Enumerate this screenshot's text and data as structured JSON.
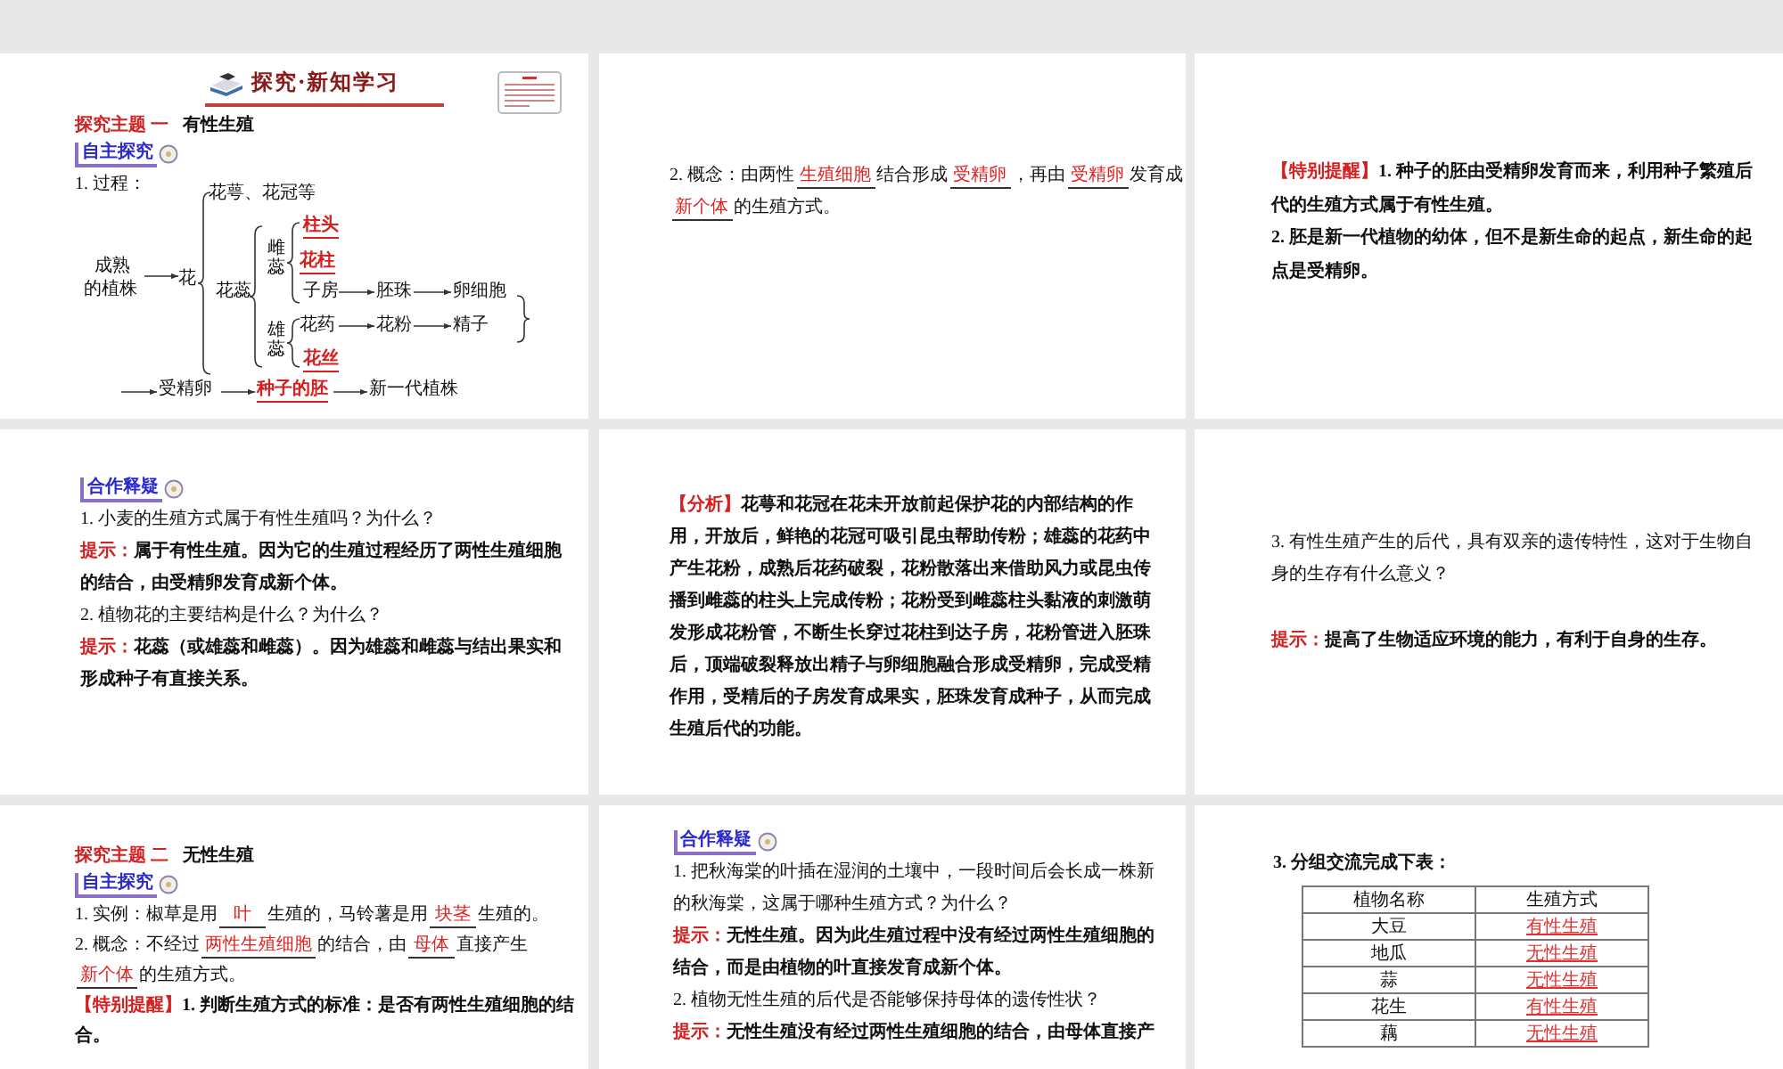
{
  "slides": [
    {
      "blocks": [
        {
          "kind": "banner",
          "text": "探究·新知学习"
        },
        {
          "kind": "topic",
          "label": "探究主题 一",
          "title": "有性生殖"
        },
        {
          "kind": "tag",
          "text": "自主探究"
        },
        {
          "kind": "para",
          "runs": [
            {
              "kind": "t",
              "text": "1. 过程："
            }
          ]
        },
        {
          "kind": "diagram",
          "nodes": [
            {
              "text": "花萼、花冠等",
              "red": false
            },
            {
              "text": "成熟",
              "red": false
            },
            {
              "text": "的植株",
              "red": false
            },
            {
              "text": "花",
              "red": false
            },
            {
              "text": "花蕊",
              "red": false
            },
            {
              "text": "雌蕊",
              "red": false
            },
            {
              "text": "柱头",
              "red": true
            },
            {
              "text": "花柱",
              "red": true
            },
            {
              "text": "子房",
              "red": false
            },
            {
              "text": "胚珠",
              "red": false
            },
            {
              "text": "卵细胞",
              "red": false
            },
            {
              "text": "雄蕊",
              "red": false
            },
            {
              "text": "花药",
              "red": false
            },
            {
              "text": "花粉",
              "red": false
            },
            {
              "text": "精子",
              "red": false
            },
            {
              "text": "花丝",
              "red": true
            },
            {
              "text": "受精卵",
              "red": false
            },
            {
              "text": "种子的胚",
              "red": true
            },
            {
              "text": "新一代植株",
              "red": false
            }
          ]
        }
      ]
    },
    {
      "blocks": [
        {
          "kind": "para",
          "runs": [
            {
              "kind": "t",
              "text": "2. 概念：由两性"
            },
            {
              "kind": "blank",
              "text": "生殖细胞"
            },
            {
              "kind": "t",
              "text": "结合形成"
            },
            {
              "kind": "blank",
              "text": "受精卵"
            },
            {
              "kind": "t",
              "text": "，再由"
            },
            {
              "kind": "blank",
              "text": "受精卵"
            },
            {
              "kind": "t",
              "text": "发育成"
            },
            {
              "kind": "blank",
              "text": "新个体"
            },
            {
              "kind": "t",
              "text": "的生殖方式。"
            }
          ]
        }
      ]
    },
    {
      "blocks": [
        {
          "kind": "para",
          "runs": [
            {
              "kind": "r",
              "text": "【特别提醒】"
            },
            {
              "kind": "b",
              "text": "1. 种子的胚由受精卵发育而来，利用种子繁殖后代的生殖方式属于有性生殖。"
            }
          ]
        },
        {
          "kind": "para",
          "runs": [
            {
              "kind": "b",
              "text": "2. 胚是新一代植物的幼体，但不是新生命的起点，新生命的起点是受精卵。"
            }
          ]
        }
      ]
    },
    {
      "blocks": [
        {
          "kind": "tag",
          "text": "合作释疑"
        },
        {
          "kind": "para",
          "runs": [
            {
              "kind": "t",
              "text": "1. 小麦的生殖方式属于有性生殖吗？为什么？"
            }
          ]
        },
        {
          "kind": "para",
          "runs": [
            {
              "kind": "r",
              "text": "提示："
            },
            {
              "kind": "b",
              "text": "属于有性生殖。因为它的生殖过程经历了两性生殖细胞的结合，由受精卵发育成新个体。"
            }
          ]
        },
        {
          "kind": "para",
          "runs": [
            {
              "kind": "t",
              "text": "2. 植物花的主要结构是什么？为什么？"
            }
          ]
        },
        {
          "kind": "para",
          "runs": [
            {
              "kind": "r",
              "text": "提示："
            },
            {
              "kind": "b",
              "text": "花蕊（或雄蕊和雌蕊）。因为雄蕊和雌蕊与结出果实和形成种子有直接关系。"
            }
          ]
        }
      ]
    },
    {
      "blocks": [
        {
          "kind": "para",
          "runs": [
            {
              "kind": "r",
              "text": "【分析】"
            },
            {
              "kind": "b",
              "text": "花萼和花冠在花未开放前起保护花的内部结构的作用，开放后，鲜艳的花冠可吸引昆虫帮助传粉；雄蕊的花药中产生花粉，成熟后花药破裂，花粉散落出来借助风力或昆虫传播到雌蕊的柱头上完成传粉；花粉受到雌蕊柱头黏液的刺激萌发形成花粉管，不断生长穿过花柱到达子房，花粉管进入胚珠后，顶端破裂释放出精子与卵细胞融合形成受精卵，完成受精作用，受精后的子房发育成果实，胚珠发育成种子，从而完成生殖后代的功能。"
            }
          ]
        }
      ]
    },
    {
      "blocks": [
        {
          "kind": "para",
          "runs": [
            {
              "kind": "t",
              "text": "3. 有性生殖产生的后代，具有双亲的遗传特性，这对于生物自身的生存有什么意义？"
            }
          ]
        },
        {
          "kind": "para",
          "runs": [
            {
              "kind": "r",
              "text": "提示："
            },
            {
              "kind": "b",
              "text": "提高了生物适应环境的能力，有利于自身的生存。"
            }
          ]
        }
      ]
    },
    {
      "blocks": [
        {
          "kind": "topic",
          "label": "探究主题 二",
          "title": "无性生殖"
        },
        {
          "kind": "tag",
          "text": "自主探究"
        },
        {
          "kind": "para",
          "runs": [
            {
              "kind": "t",
              "text": "1. 实例：椒草是用"
            },
            {
              "kind": "blank",
              "text": "叶"
            },
            {
              "kind": "t",
              "text": "生殖的，马铃薯是用"
            },
            {
              "kind": "blank",
              "text": "块茎"
            },
            {
              "kind": "t",
              "text": "生殖的。"
            }
          ]
        },
        {
          "kind": "para",
          "runs": [
            {
              "kind": "t",
              "text": "2. 概念：不经过"
            },
            {
              "kind": "blank",
              "text": "两性生殖细胞"
            },
            {
              "kind": "t",
              "text": "的结合，由"
            },
            {
              "kind": "blank",
              "text": "母体"
            },
            {
              "kind": "t",
              "text": "直接产生"
            },
            {
              "kind": "blank",
              "text": "新个体"
            },
            {
              "kind": "t",
              "text": "的生殖方式。"
            }
          ]
        },
        {
          "kind": "para",
          "runs": [
            {
              "kind": "r",
              "text": "【特别提醒】"
            },
            {
              "kind": "b",
              "text": "1. 判断生殖方式的标准：是否有两性生殖细胞的结合。"
            }
          ]
        }
      ]
    },
    {
      "blocks": [
        {
          "kind": "tag",
          "text": "合作释疑"
        },
        {
          "kind": "para",
          "runs": [
            {
              "kind": "t",
              "text": "1. 把秋海棠的叶插在湿润的土壤中，一段时间后会长成一株新的秋海棠，这属于哪种生殖方式？为什么？"
            }
          ]
        },
        {
          "kind": "para",
          "runs": [
            {
              "kind": "r",
              "text": "提示："
            },
            {
              "kind": "b",
              "text": "无性生殖。因为此生殖过程中没有经过两性生殖细胞的结合，而是由植物的叶直接发育成新个体。"
            }
          ]
        },
        {
          "kind": "para",
          "runs": [
            {
              "kind": "t",
              "text": "2. 植物无性生殖的后代是否能够保持母体的遗传性状？"
            }
          ]
        },
        {
          "kind": "para",
          "runs": [
            {
              "kind": "r",
              "text": "提示："
            },
            {
              "kind": "b",
              "text": "无性生殖没有经过两性生殖细胞的结合，由母体直接产"
            }
          ]
        }
      ]
    },
    {
      "blocks": [
        {
          "kind": "para",
          "runs": [
            {
              "kind": "b",
              "text": "3. 分组交流完成下表："
            }
          ]
        },
        {
          "kind": "table",
          "columns": [
            "植物名称",
            "生殖方式"
          ],
          "rows": [
            [
              "大豆",
              "有性生殖"
            ],
            [
              "地瓜",
              "无性生殖"
            ],
            [
              "蒜",
              "无性生殖"
            ],
            [
              "花生",
              "有性生殖"
            ],
            [
              "藕",
              "无性生殖"
            ]
          ]
        }
      ]
    }
  ]
}
